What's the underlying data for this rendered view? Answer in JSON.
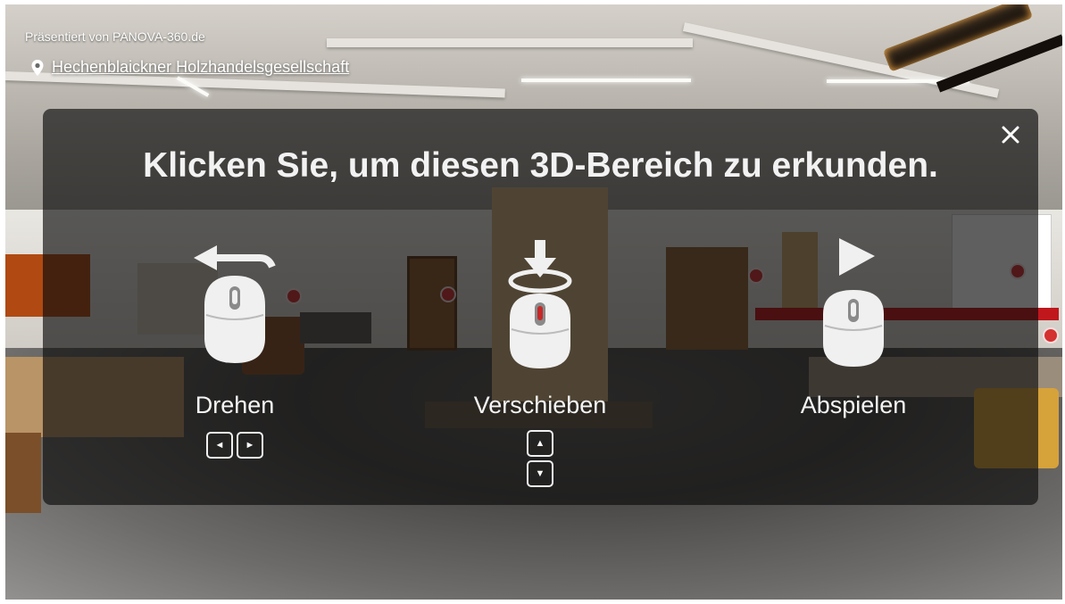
{
  "header": {
    "presenter": "Präsentiert von PANOVA-360.de",
    "location": "Hechenblaickner Holzhandelsgesellschaft"
  },
  "overlay": {
    "headline": "Klicken Sie, um diesen 3D-Bereich zu erkunden.",
    "close_icon": "close-icon",
    "items": [
      {
        "label": "Drehen",
        "icon": "mouse-rotate-icon",
        "keys": [
          "◄",
          "►"
        ]
      },
      {
        "label": "Verschieben",
        "icon": "mouse-move-icon",
        "keys": [
          "▲",
          "▼"
        ]
      },
      {
        "label": "Abspielen",
        "icon": "mouse-play-icon",
        "keys": []
      }
    ]
  },
  "colors": {
    "overlay_bg": "#0c0c0c",
    "text": "#f2f2f2",
    "mouse_body": "#f0f0f0",
    "hotspot": "#d43131"
  }
}
